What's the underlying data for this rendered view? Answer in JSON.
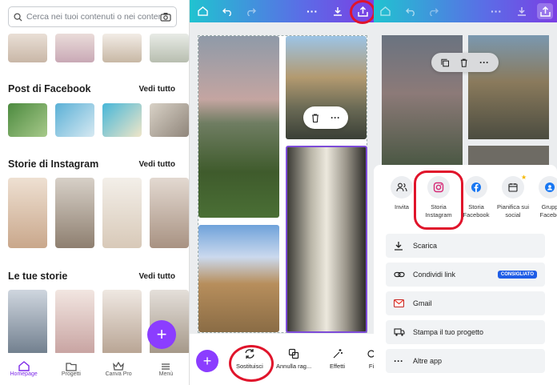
{
  "home": {
    "search_placeholder": "Cerca nei tuoi contenuti o nei content",
    "sections": [
      {
        "title": "Post di Facebook",
        "see_all": "Vedi tutto"
      },
      {
        "title": "Storie di Instagram",
        "see_all": "Vedi tutto"
      },
      {
        "title": "Le tue storie",
        "see_all": "Vedi tutto"
      }
    ],
    "tabs": [
      {
        "label": "Homepage",
        "active": true
      },
      {
        "label": "Progetti"
      },
      {
        "label": "Canva Pro"
      },
      {
        "label": "Menù"
      }
    ],
    "fab": "+"
  },
  "editor": {
    "bottom_tools": [
      {
        "label": "Sostituisci"
      },
      {
        "label": "Annulla rag..."
      },
      {
        "label": "Effetti"
      },
      {
        "label": "Fi"
      }
    ],
    "add": "+"
  },
  "share": {
    "targets": [
      {
        "label": "Invita"
      },
      {
        "label": "Storia Instagram"
      },
      {
        "label": "Storia Facebook"
      },
      {
        "label": "Pianifica sui social"
      },
      {
        "label": "Grupp Facebo"
      }
    ],
    "options": [
      {
        "label": "Scarica"
      },
      {
        "label": "Condividi link",
        "badge": "CONSIGLIATO"
      },
      {
        "label": "Gmail"
      },
      {
        "label": "Stampa il tuo progetto"
      },
      {
        "label": "Altre app"
      }
    ]
  },
  "colors": {
    "accent": "#8b3dff",
    "highlight": "#e0142b",
    "badge": "#1f5de6"
  }
}
